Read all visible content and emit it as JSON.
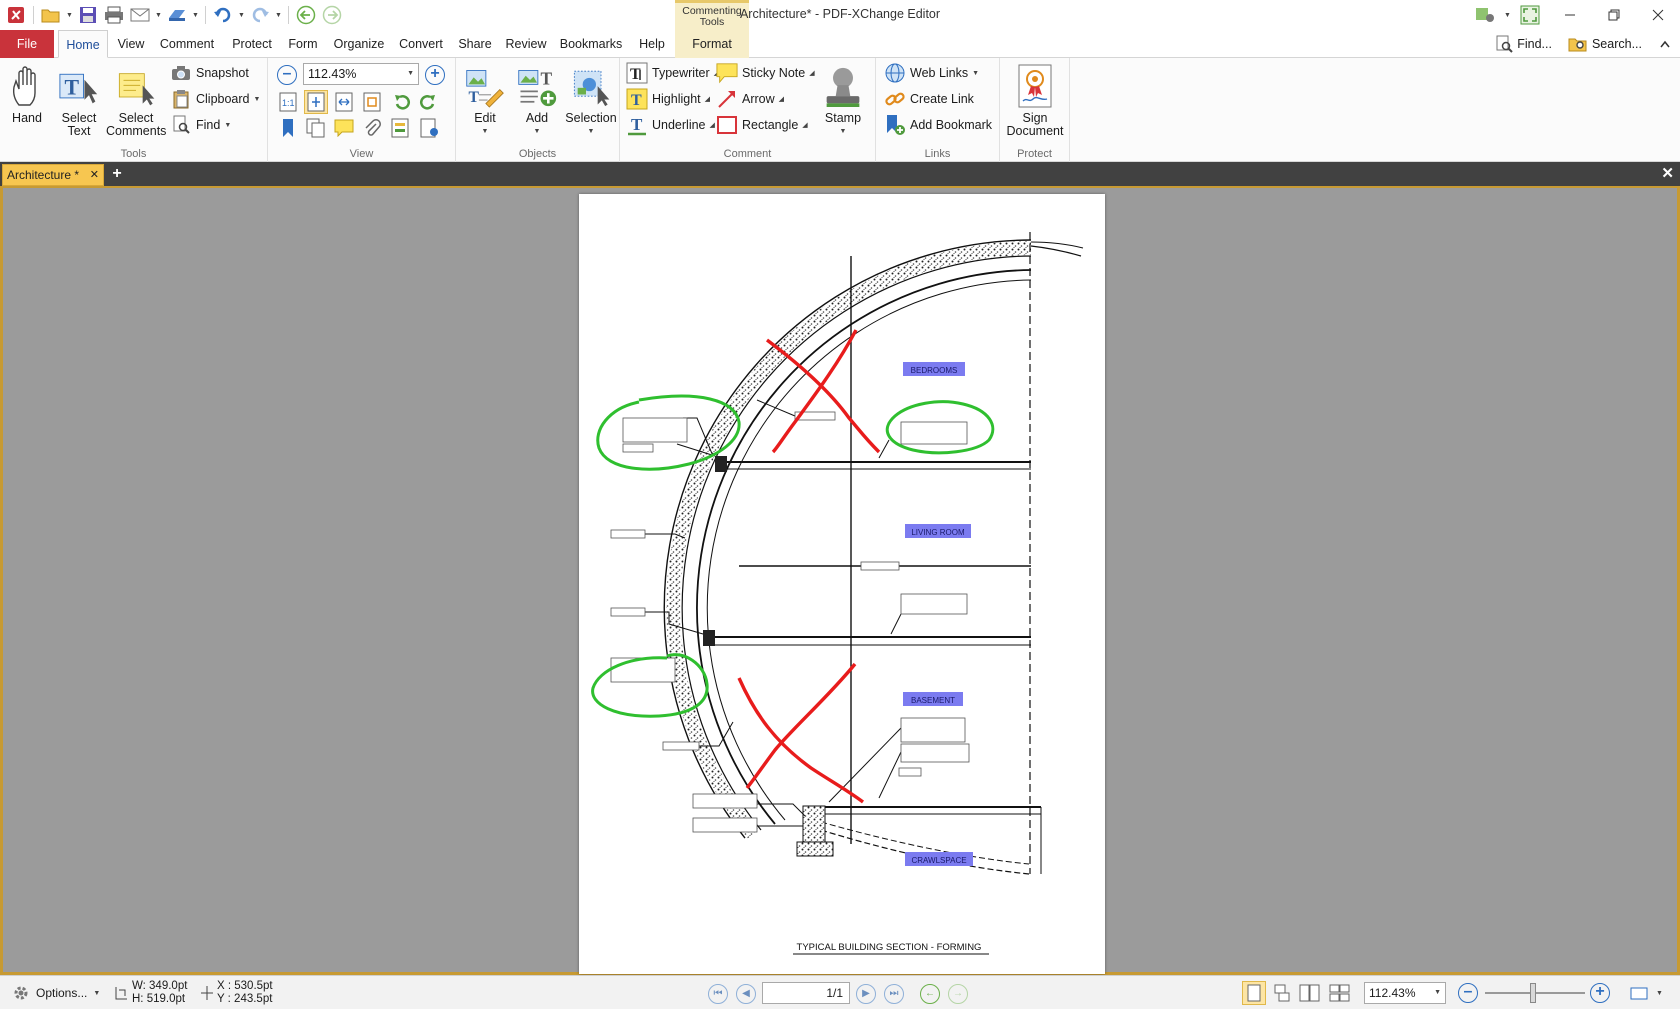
{
  "window": {
    "title": "Architecture* - PDF-XChange Editor",
    "context_tab_header": "Commenting Tools"
  },
  "menu": {
    "file": "File",
    "tabs": [
      "Home",
      "View",
      "Comment",
      "Protect",
      "Form",
      "Organize",
      "Convert",
      "Share",
      "Review",
      "Bookmarks",
      "Help"
    ],
    "format": "Format",
    "find": "Find...",
    "search": "Search..."
  },
  "ribbon": {
    "tools": {
      "label": "Tools",
      "hand": "Hand",
      "select_text": "Select Text",
      "select_comments": "Select Comments",
      "snapshot": "Snapshot",
      "clipboard": "Clipboard",
      "find": "Find"
    },
    "view": {
      "label": "View",
      "zoom": "112.43%"
    },
    "objects": {
      "label": "Objects",
      "edit": "Edit",
      "add": "Add",
      "selection": "Selection"
    },
    "comment": {
      "label": "Comment",
      "typewriter": "Typewriter",
      "sticky_note": "Sticky Note",
      "highlight": "Highlight",
      "arrow": "Arrow",
      "underline": "Underline",
      "rectangle": "Rectangle",
      "stamp": "Stamp"
    },
    "links": {
      "label": "Links",
      "web_links": "Web Links",
      "create_link": "Create Link",
      "add_bookmark": "Add Bookmark"
    },
    "protect": {
      "label": "Protect",
      "sign_document": "Sign Document"
    }
  },
  "document_tab": {
    "name": "Architecture *"
  },
  "drawing": {
    "room_labels": [
      "BEDROOMS",
      "LIVING ROOM",
      "BASEMENT",
      "CRAWLSPACE"
    ],
    "sheet_title": "TYPICAL BUILDING SECTION - FORMING",
    "markup_colors": {
      "circle": "#2fbf2f",
      "cross": "#e81c1c",
      "room_label_bg": "#7b7bf0"
    }
  },
  "status": {
    "options": "Options...",
    "width": "W: 349.0pt",
    "height": "H: 519.0pt",
    "x": "X : 530.5pt",
    "y": "Y : 243.5pt",
    "page": "1/1",
    "zoom": "112.43%"
  },
  "colors": {
    "file_tab": "#c9333b",
    "doc_tab": "#f7c650",
    "accent": "#2f6fc0"
  }
}
